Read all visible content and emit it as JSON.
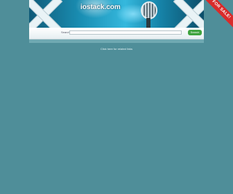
{
  "header": {
    "brand_text": "iostack.com",
    "sale_ribbon": "FOR SALE!",
    "image_icon": "microphone-icon"
  },
  "search": {
    "label": "Search",
    "placeholder": "",
    "button_label": "Search"
  },
  "footer_bar": {
    "link_text": "Click here for related links"
  },
  "colors": {
    "page_background": "#4f8e99",
    "banner_blue": "#35b8dd",
    "sale_red": "#d92b2b",
    "button_green": "#3fa33f"
  }
}
